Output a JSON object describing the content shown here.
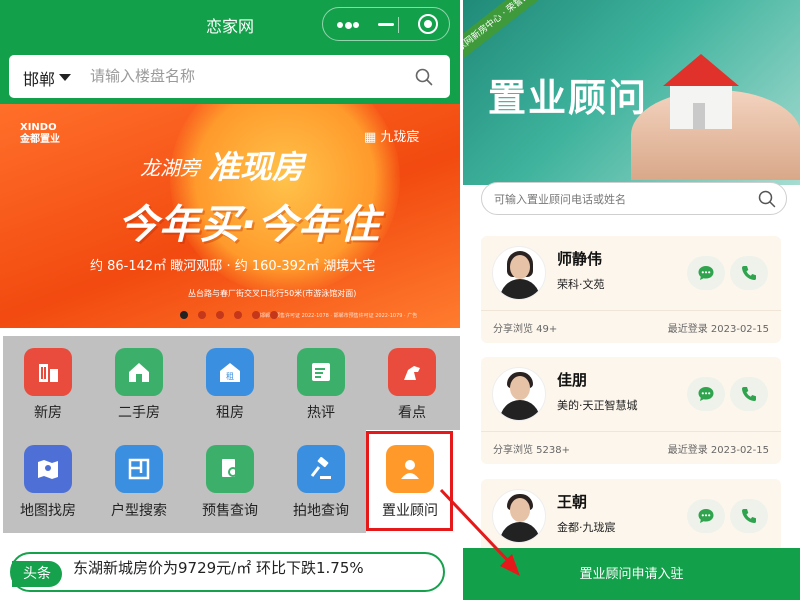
{
  "left": {
    "title": "恋家网",
    "city": "邯郸",
    "search_placeholder": "请输入楼盘名称",
    "banner": {
      "logo_left": "XINDO\n金都置业",
      "logo_right": "▦ 九珑宸",
      "line1a": "龙湖旁",
      "line1b": "准现房",
      "line2": "今年买·今年住",
      "line3": "约 86-142㎡ 瞰河观邸  ·  约 160-392㎡ 湖境大宅",
      "line4": "丛台路与春厂街交叉口北行50米(市游泳馆对面)",
      "fine": "邯郸市预售许可证 2022-1078 · 邯郸市预售许可证 2022-1079 · 广告"
    },
    "carousel_active": 0,
    "carousel_count": 6,
    "grid": [
      {
        "label": "新房",
        "icon": "building-icon",
        "color": "#e94b3c"
      },
      {
        "label": "二手房",
        "icon": "house-icon",
        "color": "#3cb06a"
      },
      {
        "label": "租房",
        "icon": "rent-icon",
        "color": "#3a8fe0"
      },
      {
        "label": "热评",
        "icon": "review-icon",
        "color": "#3cb06a"
      },
      {
        "label": "看点",
        "icon": "horse-icon",
        "color": "#e94b3c"
      },
      {
        "label": "地图找房",
        "icon": "map-icon",
        "color": "#4d6fd6"
      },
      {
        "label": "户型搜索",
        "icon": "floorplan-icon",
        "color": "#3a8fe0"
      },
      {
        "label": "预售查询",
        "icon": "doc-search-icon",
        "color": "#3cb06a"
      },
      {
        "label": "拍地查询",
        "icon": "gavel-icon",
        "color": "#3a8fe0"
      },
      {
        "label": "置业顾问",
        "icon": "advisor-icon",
        "color": "#ff9a2a"
      }
    ],
    "headline": {
      "badge": "头条",
      "text": "东湖新城房价为9729元/㎡ 环比下跌1.75%"
    }
  },
  "right": {
    "ribbon": "恋家网新房中心 · 荣誉出品",
    "hero_title": "置业顾问",
    "search_placeholder": "可输入置业顾问电话或姓名",
    "advisors": [
      {
        "name": "师静伟",
        "project": "荣科·文苑",
        "views": "分享浏览 49+",
        "last_login": "最近登录 2023-02-15",
        "gender": "f"
      },
      {
        "name": "佳朋",
        "project": "美的·天正智慧城",
        "views": "分享浏览 5238+",
        "last_login": "最近登录 2023-02-15",
        "gender": "m"
      },
      {
        "name": "王朝",
        "project": "金都·九珑宸",
        "views": "",
        "last_login": "",
        "gender": "m"
      }
    ],
    "apply_label": "置业顾问申请入驻"
  },
  "colors": {
    "brand_green": "#13a04a",
    "highlight_red": "#e5191a"
  }
}
